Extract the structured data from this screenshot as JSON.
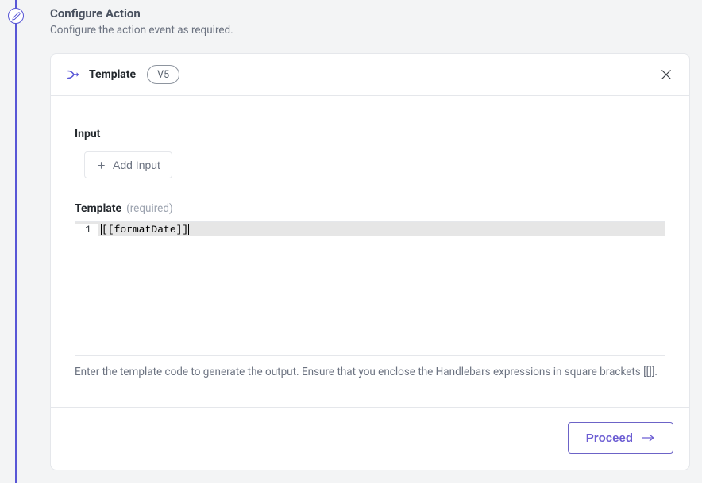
{
  "header": {
    "title": "Configure Action",
    "subtitle": "Configure the action event as required."
  },
  "step": {
    "title": "Template",
    "version": "V5"
  },
  "input_section": {
    "label": "Input",
    "add_button": "Add Input"
  },
  "template_section": {
    "label": "Template",
    "required_label": "(required)",
    "line_number": "1",
    "code_content": "[[formatDate]]",
    "helper_text": "Enter the template code to generate the output. Ensure that you enclose the Handlebars expressions in square brackets [[]]."
  },
  "footer": {
    "proceed_label": "Proceed"
  }
}
